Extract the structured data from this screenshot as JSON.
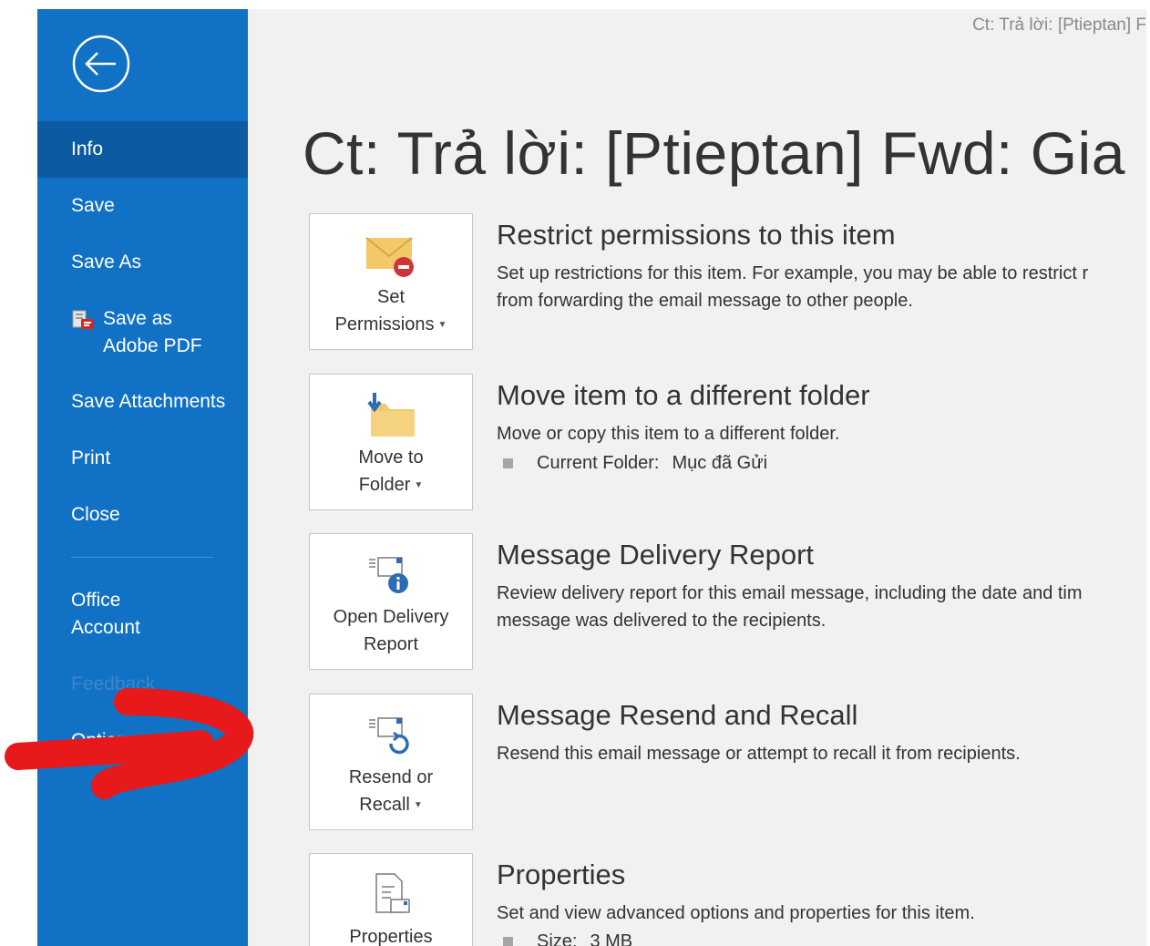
{
  "window_title": "Ct: Trả lời: [Ptieptan] F",
  "page_title": "Ct: Trả lời: [Ptieptan] Fwd: Gia",
  "sidebar": {
    "back_icon": "back-arrow-icon",
    "items": [
      {
        "label": "Info",
        "selected": true
      },
      {
        "label": "Save"
      },
      {
        "label": "Save As"
      },
      {
        "label_line1": "Save as",
        "label_line2": "Adobe PDF",
        "icon": "adobe-pdf-icon"
      },
      {
        "label": "Save Attachments"
      },
      {
        "label": "Print"
      },
      {
        "label": "Close"
      },
      {
        "label_line1": "Office",
        "label_line2": "Account"
      },
      {
        "label": "Feedback",
        "disabled": true
      },
      {
        "label": "Options"
      }
    ]
  },
  "sections": [
    {
      "button_line1": "Set",
      "button_line2": "Permissions",
      "icon": "envelope-restrict-icon",
      "title": "Restrict permissions to this item",
      "desc_line1": "Set up restrictions for this item. For example, you may be able to restrict r",
      "desc_line2": "from forwarding the email message to other people."
    },
    {
      "button_line1": "Move to",
      "button_line2": "Folder",
      "icon": "move-folder-icon",
      "title": "Move item to a different folder",
      "desc_line1": "Move or copy this item to a different folder.",
      "bullet_label": "Current Folder:",
      "bullet_value": "Mục đã Gửi"
    },
    {
      "button_line1": "Open Delivery",
      "button_line2": "Report",
      "icon": "delivery-report-icon",
      "title": "Message Delivery Report",
      "desc_line1": "Review delivery report for this email message, including the date and tim",
      "desc_line2": "message was delivered to the recipients."
    },
    {
      "button_line1": "Resend or",
      "button_line2": "Recall",
      "icon": "resend-recall-icon",
      "title": "Message Resend and Recall",
      "desc_line1": "Resend this email message or attempt to recall it from recipients."
    },
    {
      "button_line1": "Properties",
      "icon": "properties-icon",
      "title": "Properties",
      "desc_line1": "Set and view advanced options and properties for this item.",
      "bullet_label": "Size:",
      "bullet_value": "3 MB"
    }
  ],
  "colors": {
    "sidebar": "#1171c5",
    "sidebar_selected": "#0b5aa2",
    "main_bg": "#f1f1f1",
    "annotation": "#e8191a"
  }
}
